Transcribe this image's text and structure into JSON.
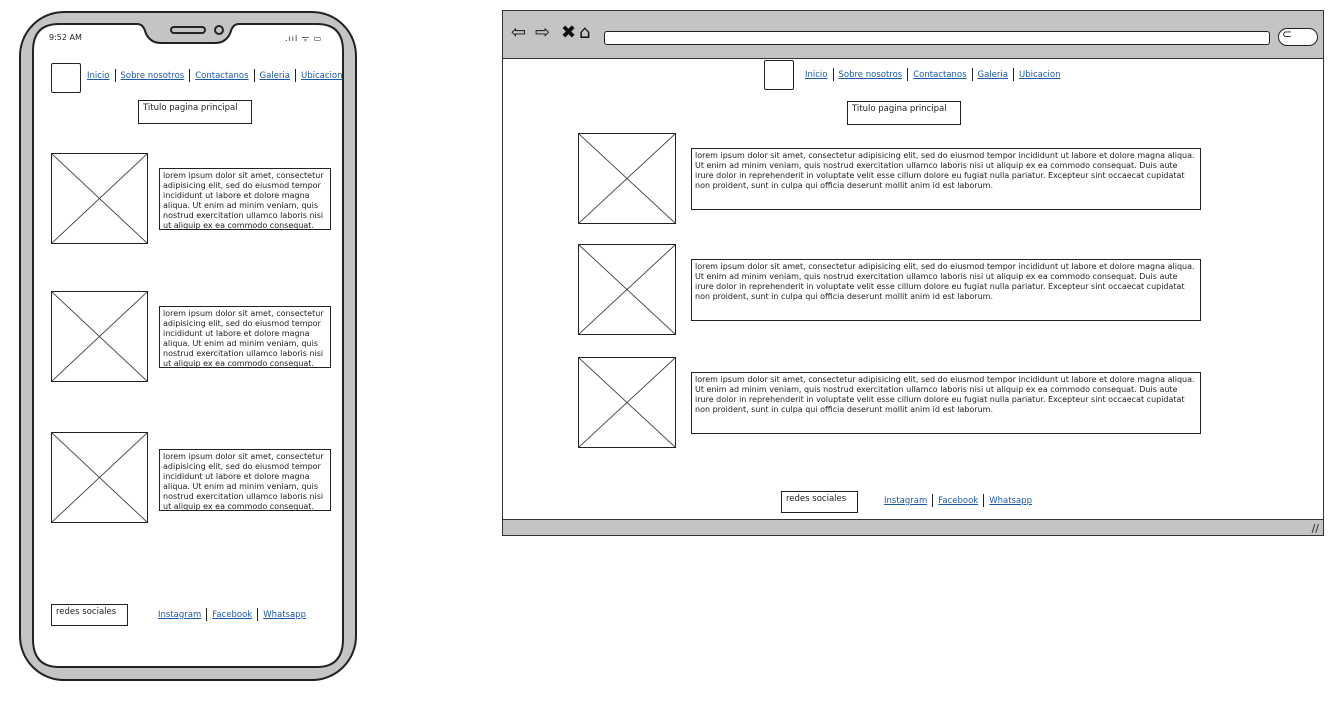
{
  "mobile": {
    "status_time": "9:52 AM",
    "status_icons": ".ııl ᯤ ▭",
    "nav": [
      "Inicio",
      "Sobre nosotros",
      "Contactanos",
      "Galeria",
      "Ubicacion"
    ],
    "page_title": "Titulo pagina principal",
    "items": [
      {
        "text": "lorem ipsum dolor sit amet, consectetur adipisicing elit, sed do eiusmod tempor incididunt ut labore et dolore magna aliqua. Ut enim ad minim veniam, quis nostrud exercitation ullamco laboris nisi ut aliquip ex ea commodo consequat. Duis"
      },
      {
        "text": "lorem ipsum dolor sit amet, consectetur adipisicing elit, sed do eiusmod tempor incididunt ut labore et dolore magna aliqua. Ut enim ad minim veniam, quis nostrud exercitation ullamco laboris nisi ut aliquip ex ea commodo consequat. Duis"
      },
      {
        "text": "lorem ipsum dolor sit amet, consectetur adipisicing elit, sed do eiusmod tempor incididunt ut labore et dolore magna aliqua. Ut enim ad minim veniam, quis nostrud exercitation ullamco laboris nisi ut aliquip ex ea commodo consequat. Duis"
      }
    ],
    "footer_label": "redes sociales",
    "social": [
      "Instagram",
      "Facebook",
      "Whatsapp"
    ]
  },
  "desktop": {
    "toolbar_icons": [
      "back-arrow-icon",
      "forward-arrow-icon",
      "close-icon",
      "home-icon"
    ],
    "nav": [
      "Inicio",
      "Sobre nosotros",
      "Contactanos",
      "Galeria",
      "Ubicacion"
    ],
    "page_title": "Titulo pagina principal",
    "items": [
      {
        "text": "lorem ipsum dolor sit amet, consectetur adipisicing elit, sed do eiusmod tempor incididunt ut labore et dolore magna aliqua. Ut enim ad minim veniam, quis nostrud exercitation ullamco laboris nisi ut aliquip ex ea commodo consequat. Duis aute irure dolor in reprehenderit in voluptate velit esse cillum dolore eu fugiat nulla pariatur. Excepteur sint occaecat cupidatat non proident, sunt in culpa qui officia deserunt mollit anim id est laborum."
      },
      {
        "text": "lorem ipsum dolor sit amet, consectetur adipisicing elit, sed do eiusmod tempor incididunt ut labore et dolore magna aliqua. Ut enim ad minim veniam, quis nostrud exercitation ullamco laboris nisi ut aliquip ex ea commodo consequat. Duis aute irure dolor in reprehenderit in voluptate velit esse cillum dolore eu fugiat nulla pariatur. Excepteur sint occaecat cupidatat non proident, sunt in culpa qui officia deserunt mollit anim id est laborum."
      },
      {
        "text": "lorem ipsum dolor sit amet, consectetur adipisicing elit, sed do eiusmod tempor incididunt ut labore et dolore magna aliqua. Ut enim ad minim veniam, quis nostrud exercitation ullamco laboris nisi ut aliquip ex ea commodo consequat. Duis aute irure dolor in reprehenderit in voluptate velit esse cillum dolore eu fugiat nulla pariatur. Excepteur sint occaecat cupidatat non proident, sunt in culpa qui officia deserunt mollit anim id est laborum."
      }
    ],
    "footer_label": "redes sociales",
    "social": [
      "Instagram",
      "Facebook",
      "Whatsapp"
    ]
  },
  "colors": {
    "link": "#1a5aa8",
    "chrome": "#c4c4c4",
    "stroke": "#222222"
  }
}
